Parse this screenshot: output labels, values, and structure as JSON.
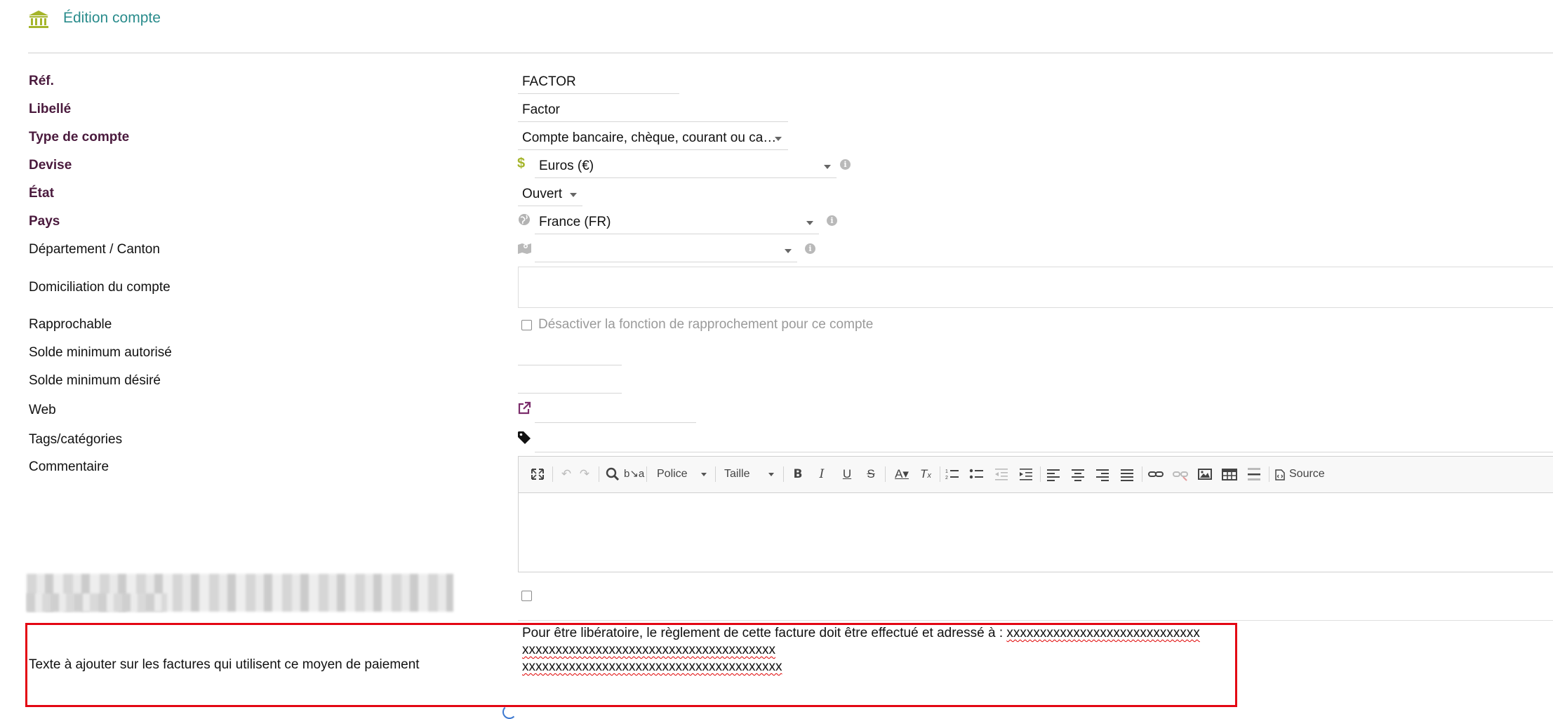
{
  "header": {
    "title": "Édition compte",
    "icon": "bank-icon",
    "icon_color": "#a5b52b",
    "title_color": "#2a8c8c"
  },
  "fields": {
    "ref": {
      "label": "Réf.",
      "value": "FACTOR"
    },
    "libelle": {
      "label": "Libellé",
      "value": "Factor"
    },
    "type_compte": {
      "label": "Type de compte",
      "value": "Compte bancaire, chèque, courant ou ca…"
    },
    "devise": {
      "label": "Devise",
      "value": "Euros (€)",
      "icon": "dollar-icon"
    },
    "etat": {
      "label": "État",
      "value": "Ouvert"
    },
    "pays": {
      "label": "Pays",
      "value": "France (FR)",
      "icon": "globe-icon"
    },
    "departement": {
      "label": "Département / Canton",
      "value": "",
      "icon": "map-icon"
    },
    "domiciliation": {
      "label": "Domiciliation du compte",
      "value": ""
    },
    "rapprochable": {
      "label": "Rapprochable",
      "checkbox_label": "Désactiver la fonction de rapprochement pour ce compte",
      "checked": false
    },
    "solde_min_autorise": {
      "label": "Solde minimum autorisé",
      "value": ""
    },
    "solde_min_desire": {
      "label": "Solde minimum désiré",
      "value": ""
    },
    "web": {
      "label": "Web",
      "value": "",
      "icon": "external-link-icon"
    },
    "tags": {
      "label": "Tags/catégories",
      "value": "",
      "icon": "tag-icon"
    },
    "commentaire": {
      "label": "Commentaire"
    },
    "texte_factures": {
      "label": "Texte à ajouter sur les factures qui utilisent ce moyen de paiement",
      "line1_prefix": "Pour être libératoire, le règlement de cette facture doit être effectué et adressé à : ",
      "line1_x": "xxxxxxxxxxxxxxxxxxxxxxxxxxxxx",
      "line2": "xxxxxxxxxxxxxxxxxxxxxxxxxxxxxxxxxxxxxx",
      "line3": "xxxxxxxxxxxxxxxxxxxxxxxxxxxxxxxxxxxxxxx"
    }
  },
  "editor_toolbar": {
    "font_label": "Police",
    "size_label": "Taille",
    "source_label": "Source",
    "icons": [
      "maximize-icon",
      "undo-icon",
      "redo-icon",
      "find-icon",
      "replace-icon",
      "bold-icon",
      "italic-icon",
      "underline-icon",
      "strike-icon",
      "text-color-icon",
      "remove-format-icon",
      "numbered-list-icon",
      "bulleted-list-icon",
      "outdent-icon",
      "indent-icon",
      "align-left-icon",
      "align-center-icon",
      "align-right-icon",
      "justify-icon",
      "link-icon",
      "unlink-icon",
      "image-icon",
      "table-icon",
      "horizontal-rule-icon",
      "source-icon"
    ]
  },
  "colors": {
    "required_label": "#4a1a3d",
    "highlight_border": "#e30613"
  }
}
